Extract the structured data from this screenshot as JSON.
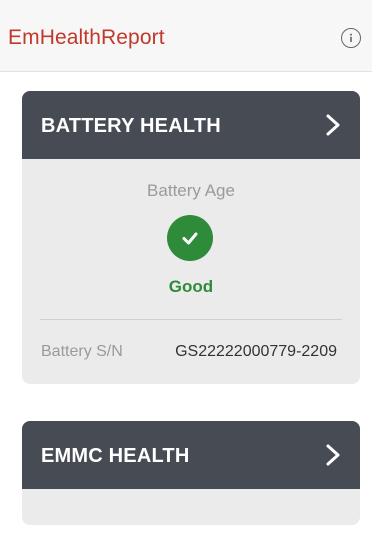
{
  "app": {
    "title": "EmHealthReport",
    "info_icon": "info-icon",
    "accent_color": "#c0392b"
  },
  "cards": [
    {
      "title": "BATTERY HEALTH",
      "chevron_icon": "chevron-right-icon",
      "metric_label": "Battery Age",
      "status_icon": "check-circle-icon",
      "status_text": "Good",
      "status_color": "#2e8b3a",
      "serial_label": "Battery S/N",
      "serial_value": "GS22222000779-2209"
    },
    {
      "title": "EMMC HEALTH",
      "chevron_icon": "chevron-right-icon"
    }
  ]
}
